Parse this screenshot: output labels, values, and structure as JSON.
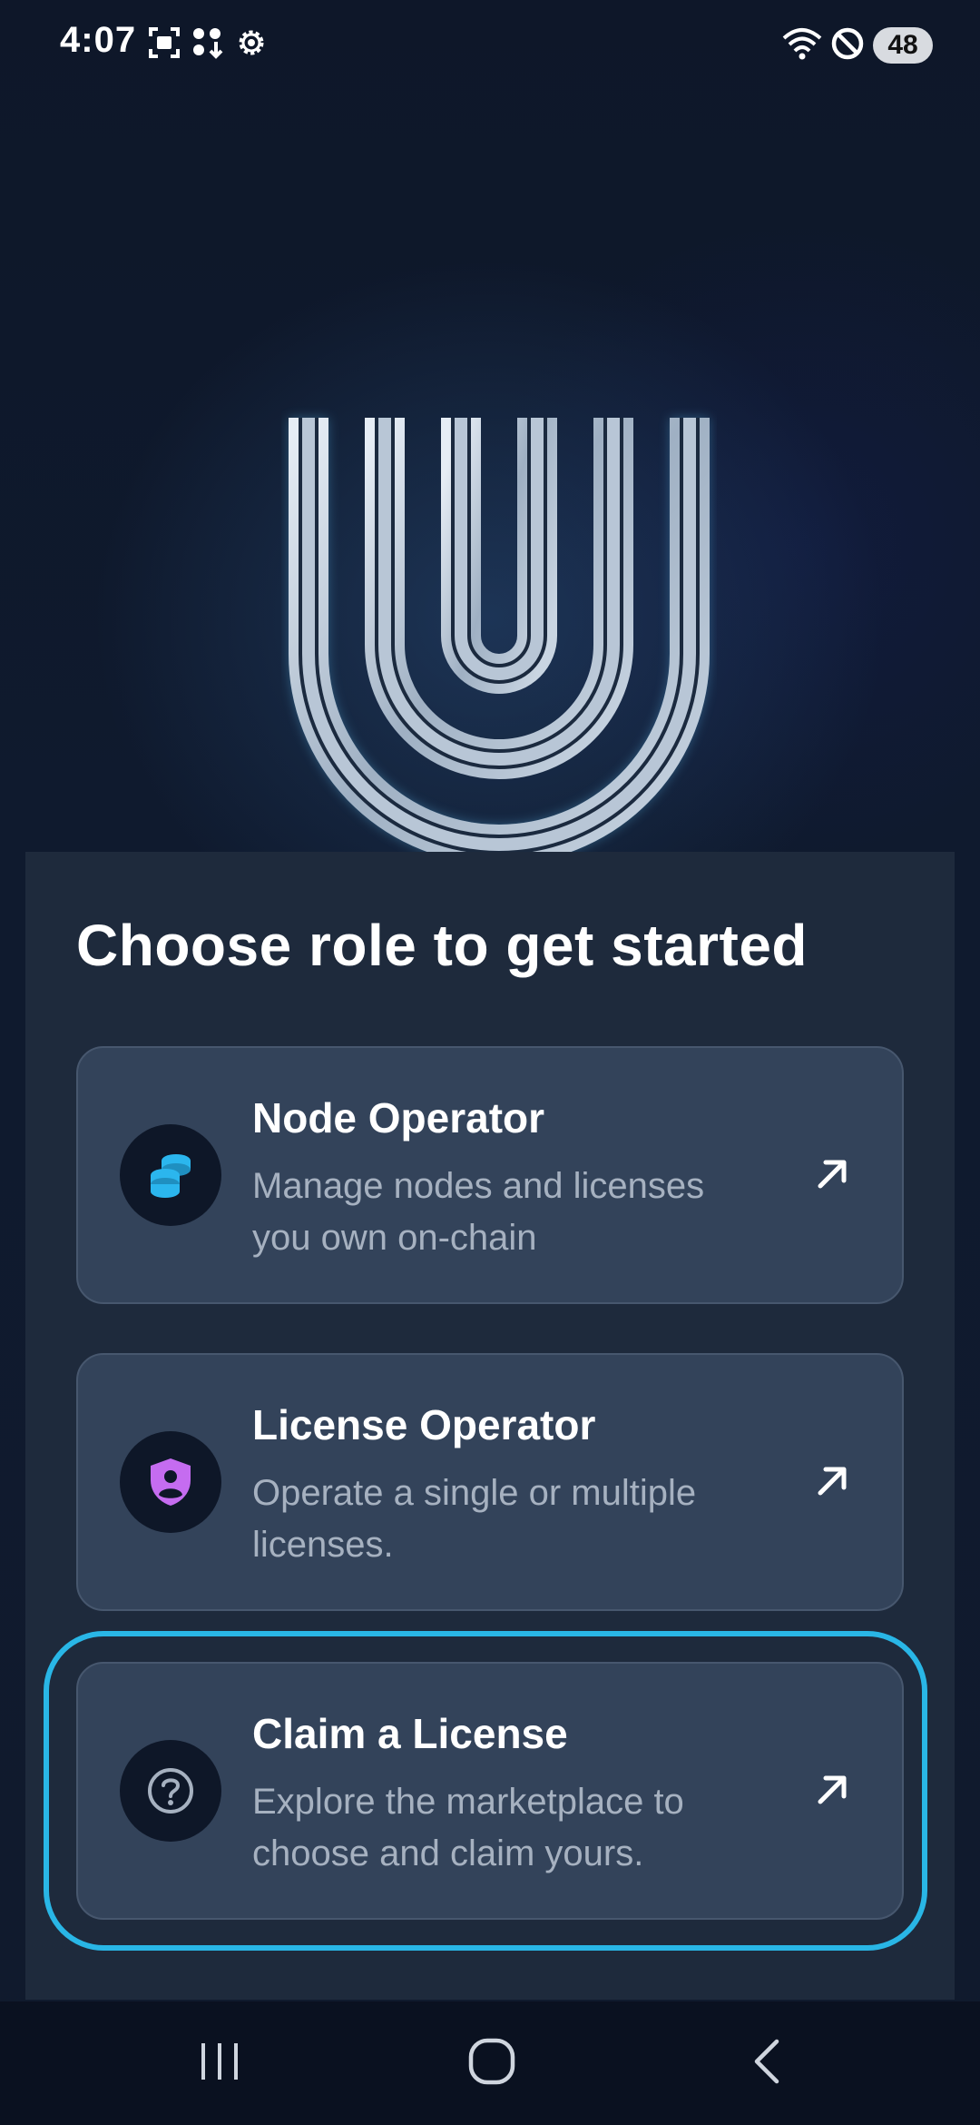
{
  "status_bar": {
    "time": "4:07",
    "battery": "48",
    "icons": [
      "screenshot-icon",
      "download-icon",
      "settings-gear-icon",
      "wifi-icon",
      "do-not-disturb-icon",
      "battery-icon"
    ]
  },
  "logo": {
    "name": "U-logo"
  },
  "sheet": {
    "heading": "Choose role to get started",
    "roles": [
      {
        "title": "Node Operator",
        "description": "Manage nodes and licenses you own on-chain",
        "icon": "coins-stack-icon"
      },
      {
        "title": "License Operator",
        "description": "Operate a single or multiple licenses.",
        "icon": "shield-user-icon"
      },
      {
        "title": "Claim a License",
        "description": "Explore the marketplace to choose and claim yours.",
        "icon": "question-circle-icon"
      }
    ]
  },
  "nav_bar": {
    "buttons": [
      "recent-apps",
      "home",
      "back"
    ]
  },
  "colors": {
    "highlight": "#29b6e6",
    "accent_blue": "#2bb6ee",
    "accent_purple": "#c56cf0"
  }
}
